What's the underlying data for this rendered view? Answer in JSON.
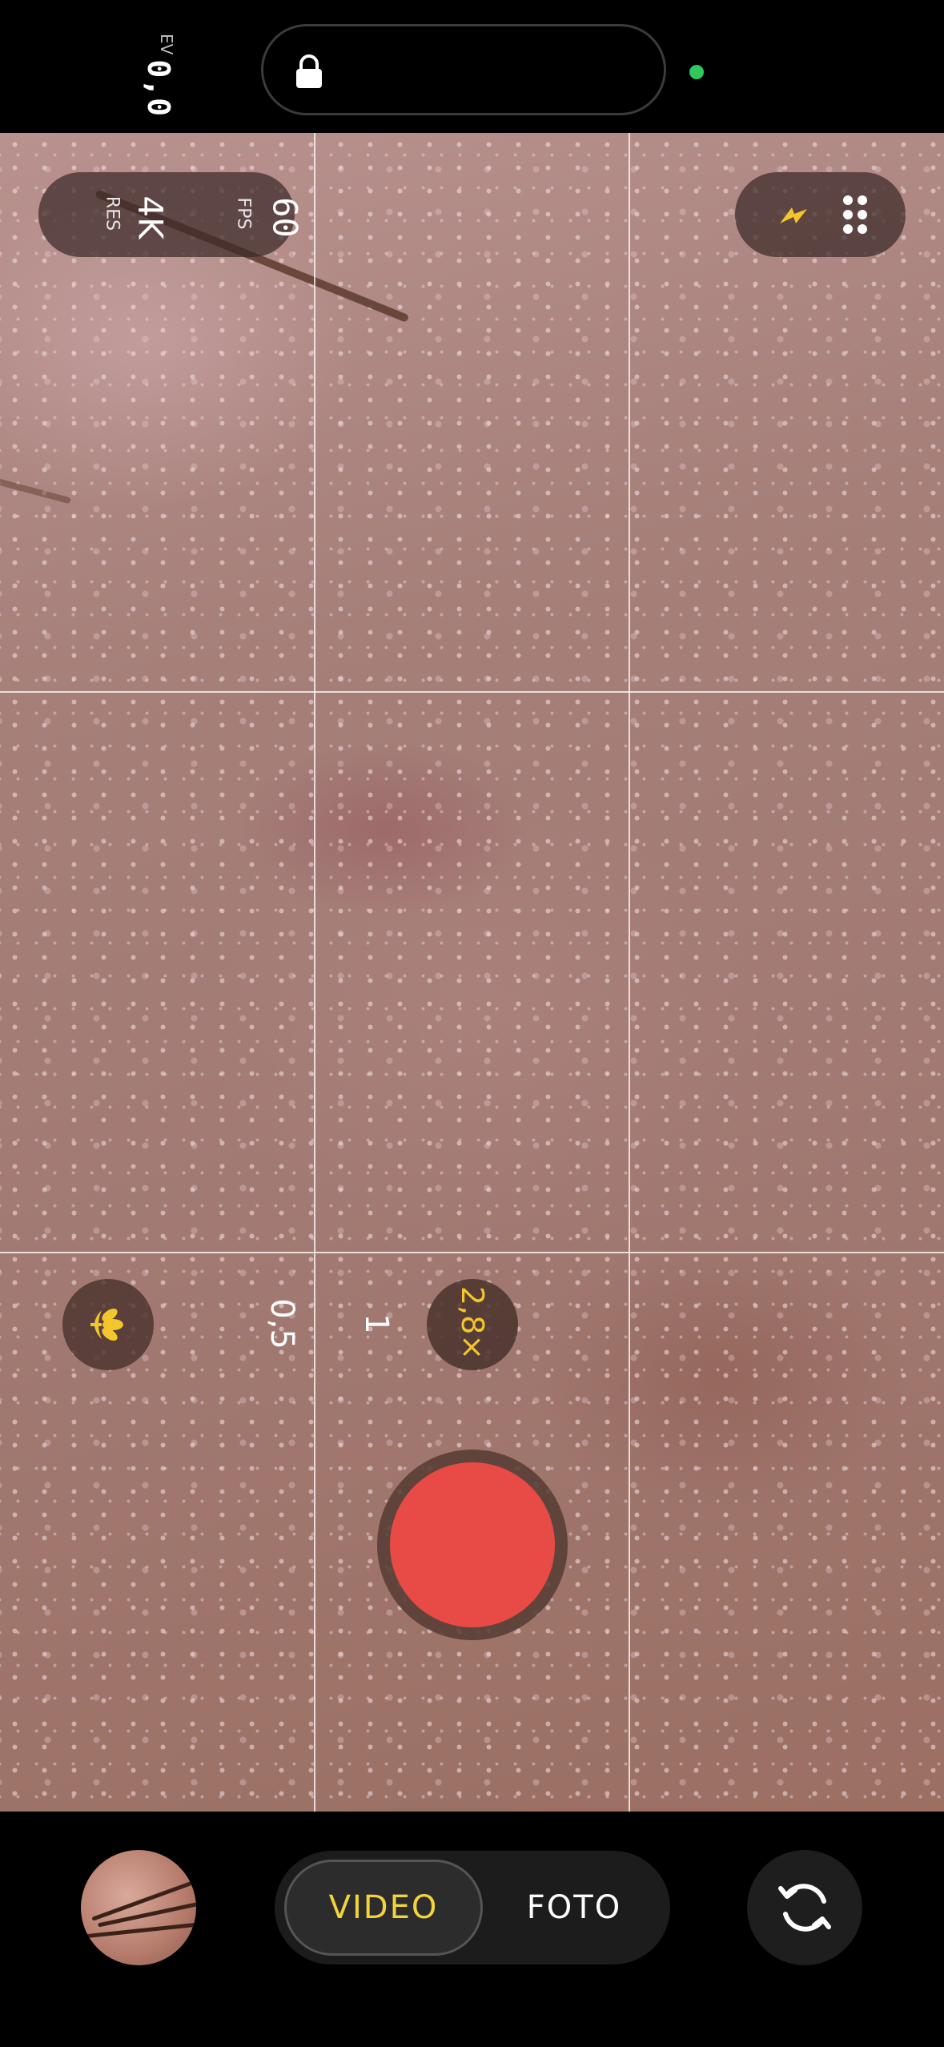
{
  "status": {
    "ev_label": "EV",
    "ev_value": "0,0",
    "privacy_indicator_color": "#2fc85a"
  },
  "quick_settings": {
    "resolution_value": "4K",
    "resolution_label": "RES",
    "fps_value": "60",
    "fps_label": "FPS",
    "flash_icon": "lightning-bolt-icon",
    "flash_color": "#f3c62b",
    "more_icon": "six-dot-grid-icon"
  },
  "zoom": {
    "macro_icon": "flower-macro-icon",
    "levels": [
      "0,5",
      "1",
      "2,8×"
    ],
    "active": "2,8×",
    "active_color": "#f3c62b"
  },
  "record": {
    "color": "#e84b45"
  },
  "modes": {
    "video": "VIDEO",
    "photo": "FOTO",
    "active": "VIDEO",
    "active_color": "#f3d33b"
  },
  "controls": {
    "flip_icon": "camera-flip-icon",
    "gallery": "last-capture-thumbnail"
  }
}
